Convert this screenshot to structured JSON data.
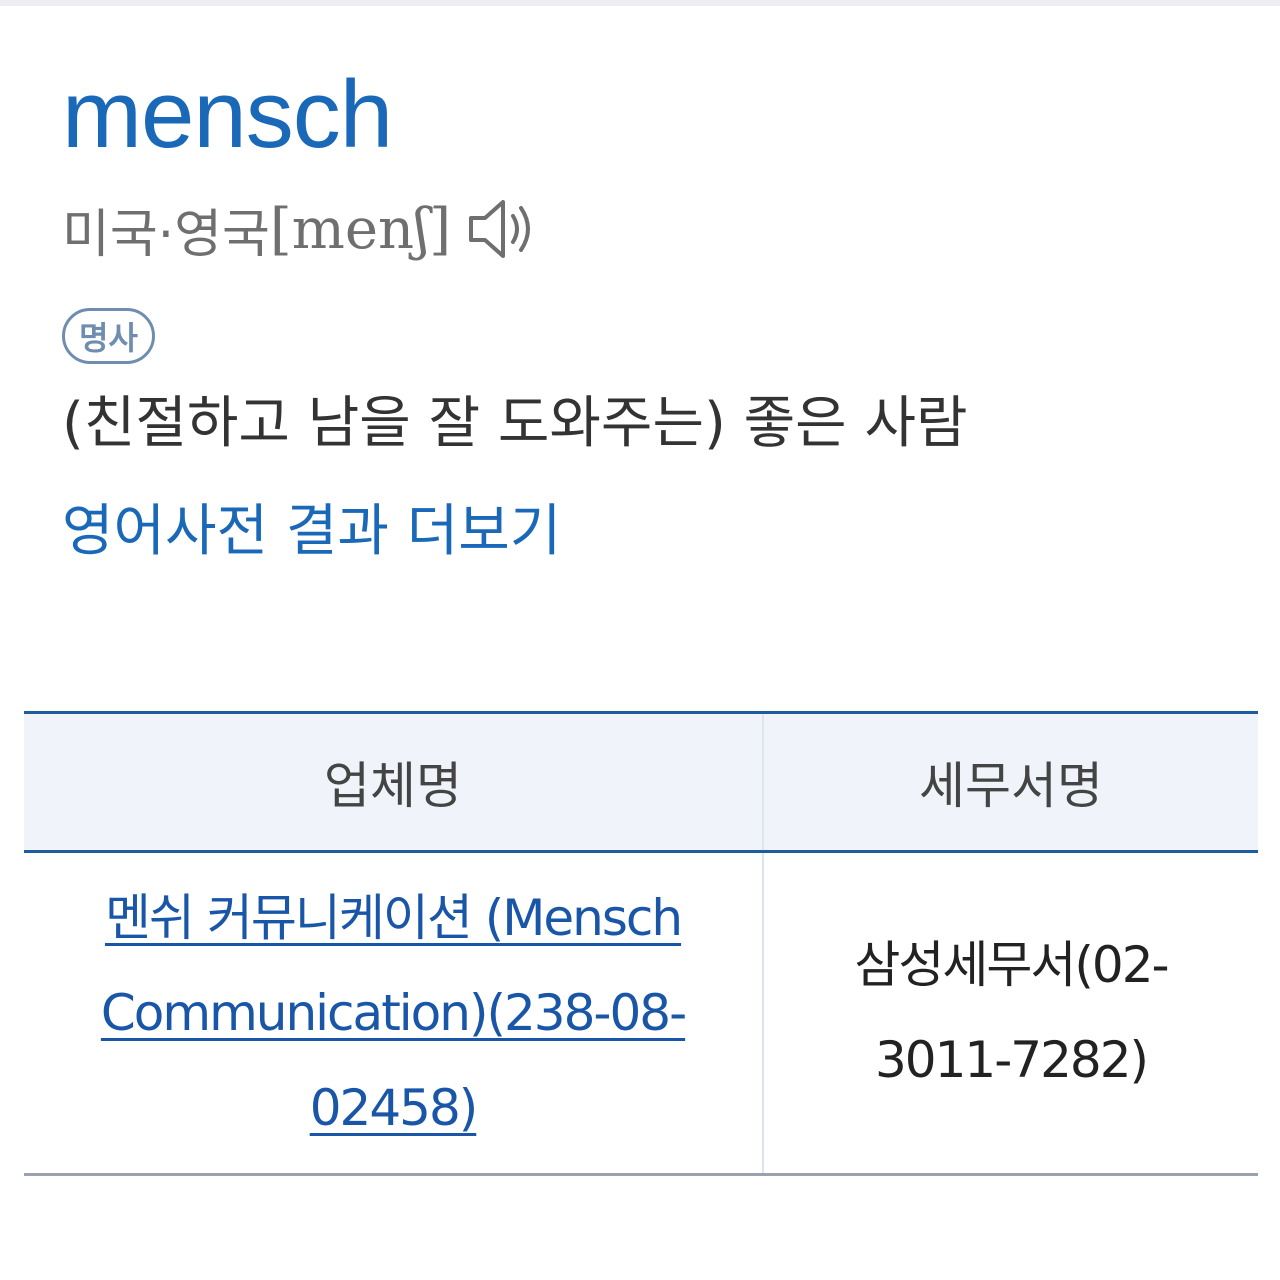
{
  "dictionary": {
    "headword": "mensch",
    "pronunciation": {
      "region": "미국·영국",
      "ipa": "[menʃ]",
      "audio_icon": "speaker-icon"
    },
    "part_of_speech": "명사",
    "meaning": "(친절하고 남을 잘 도와주는) 좋은 사람",
    "more_link": "영어사전 결과 더보기"
  },
  "business_table": {
    "headers": [
      "업체명",
      "세무서명"
    ],
    "rows": [
      {
        "company": "멘쉬 커뮤니케이션 (Mensch Communication)(238-08-02458)",
        "tax_office": "삼성세무서(02-3011-7282)"
      }
    ]
  },
  "colors": {
    "accent_blue": "#1a68b8",
    "link_blue": "#1a56a8",
    "header_bg": "#f0f4fa",
    "table_rule": "#1f5c9c",
    "muted_text": "#6f6f6f"
  }
}
